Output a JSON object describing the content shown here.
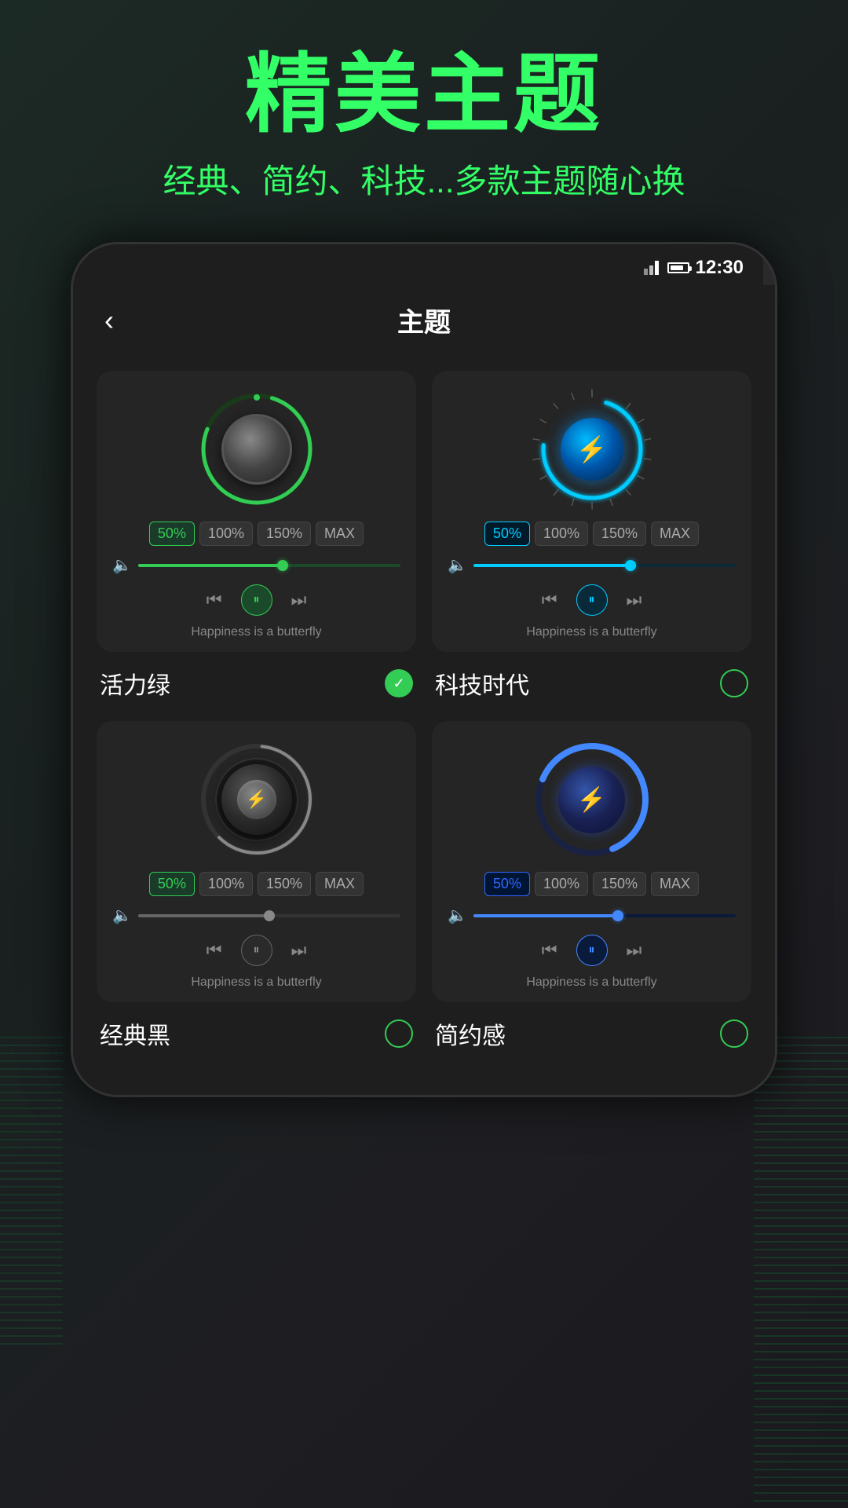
{
  "page": {
    "bg_color": "#1a2020",
    "main_title": "精美主题",
    "sub_title": "经典、简约、科技...多款主题随心换"
  },
  "phone": {
    "status_bar": {
      "time": "12:30"
    },
    "header": {
      "back_label": "‹",
      "title": "主题"
    }
  },
  "themes": [
    {
      "id": "vitality-green",
      "name": "活力绿",
      "selected": true,
      "pct_buttons": [
        "50%",
        "100%",
        "150%",
        "MAX"
      ],
      "active_pct": 0,
      "song_title": "Happiness is a butterfly",
      "style": "green"
    },
    {
      "id": "tech-era",
      "name": "科技时代",
      "selected": false,
      "pct_buttons": [
        "50%",
        "100%",
        "150%",
        "MAX"
      ],
      "active_pct": 0,
      "song_title": "Happiness is a butterfly",
      "style": "cyan"
    },
    {
      "id": "classic-black",
      "name": "经典黑",
      "selected": false,
      "pct_buttons": [
        "50%",
        "100%",
        "150%",
        "MAX"
      ],
      "active_pct": 0,
      "song_title": "Happiness is a butterfly",
      "style": "gray"
    },
    {
      "id": "simple-feel",
      "name": "简约感",
      "selected": false,
      "pct_buttons": [
        "50%",
        "100%",
        "150%",
        "MAX"
      ],
      "active_pct": 0,
      "song_title": "Happiness is a butterfly",
      "style": "blue"
    }
  ]
}
